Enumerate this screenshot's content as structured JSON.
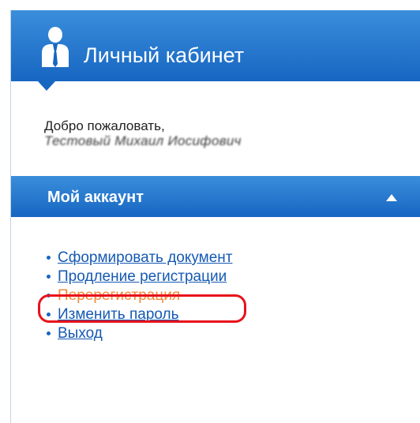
{
  "header": {
    "title": "Личный кабинет",
    "icon": "user-icon"
  },
  "welcome": {
    "greeting": "Добро пожаловать,",
    "user_name": "Тестовый Михаил Иосифович"
  },
  "account": {
    "title": "Мой аккаунт",
    "toggle_icon": "triangle-up-icon",
    "menu": [
      {
        "label": "Сформировать документ",
        "active": false
      },
      {
        "label": "Продление регистрации",
        "active": false
      },
      {
        "label": "Перерегистрация",
        "active": true
      },
      {
        "label": "Изменить пароль",
        "active": false
      },
      {
        "label": "Выход",
        "active": false
      }
    ]
  },
  "colors": {
    "header_blue": "#1766c2",
    "link_blue": "#1559b3",
    "active_link": "#f28a3a",
    "highlight_ring": "#e8121b"
  }
}
